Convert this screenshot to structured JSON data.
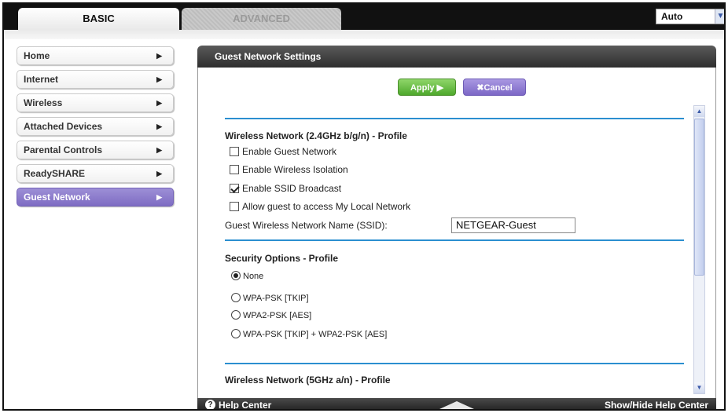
{
  "tabs": {
    "basic": "BASIC",
    "advanced": "ADVANCED"
  },
  "language": {
    "selected": "Auto",
    "arrow_icon": "chevron-down-icon"
  },
  "sidebar": {
    "items": [
      {
        "label": "Home"
      },
      {
        "label": "Internet"
      },
      {
        "label": "Wireless"
      },
      {
        "label": "Attached Devices"
      },
      {
        "label": "Parental Controls"
      },
      {
        "label": "ReadySHARE"
      },
      {
        "label": "Guest Network",
        "active": true
      }
    ],
    "arrow": "▶"
  },
  "panel": {
    "title": "Guest Network Settings",
    "apply_label": "Apply ▶",
    "cancel_label": "✖Cancel",
    "section_24": {
      "title": "Wireless Network (2.4GHz b/g/n) - Profile",
      "options": [
        {
          "label": "Enable Guest Network",
          "checked": false
        },
        {
          "label": "Enable Wireless Isolation",
          "checked": false
        },
        {
          "label": "Enable SSID Broadcast",
          "checked": true
        },
        {
          "label": "Allow guest to access My Local Network",
          "checked": false
        }
      ],
      "ssid_label": "Guest Wireless Network Name (SSID):",
      "ssid_value": "NETGEAR-Guest"
    },
    "security": {
      "title": "Security Options - Profile",
      "options": [
        {
          "label": "None",
          "checked": true
        },
        {
          "label": "WPA-PSK [TKIP]",
          "checked": false
        },
        {
          "label": "WPA2-PSK [AES]",
          "checked": false
        },
        {
          "label": "WPA-PSK [TKIP] + WPA2-PSK [AES]",
          "checked": false
        }
      ]
    },
    "section_5": {
      "title": "Wireless Network (5GHz a/n) - Profile"
    }
  },
  "footer": {
    "help_center": "Help Center",
    "help_icon": "?",
    "show_hide": "Show/Hide Help Center"
  },
  "colors": {
    "accent_purple": "#7e6cc3",
    "apply_green": "#4ea82c",
    "divider_blue": "#2b8fd0"
  }
}
